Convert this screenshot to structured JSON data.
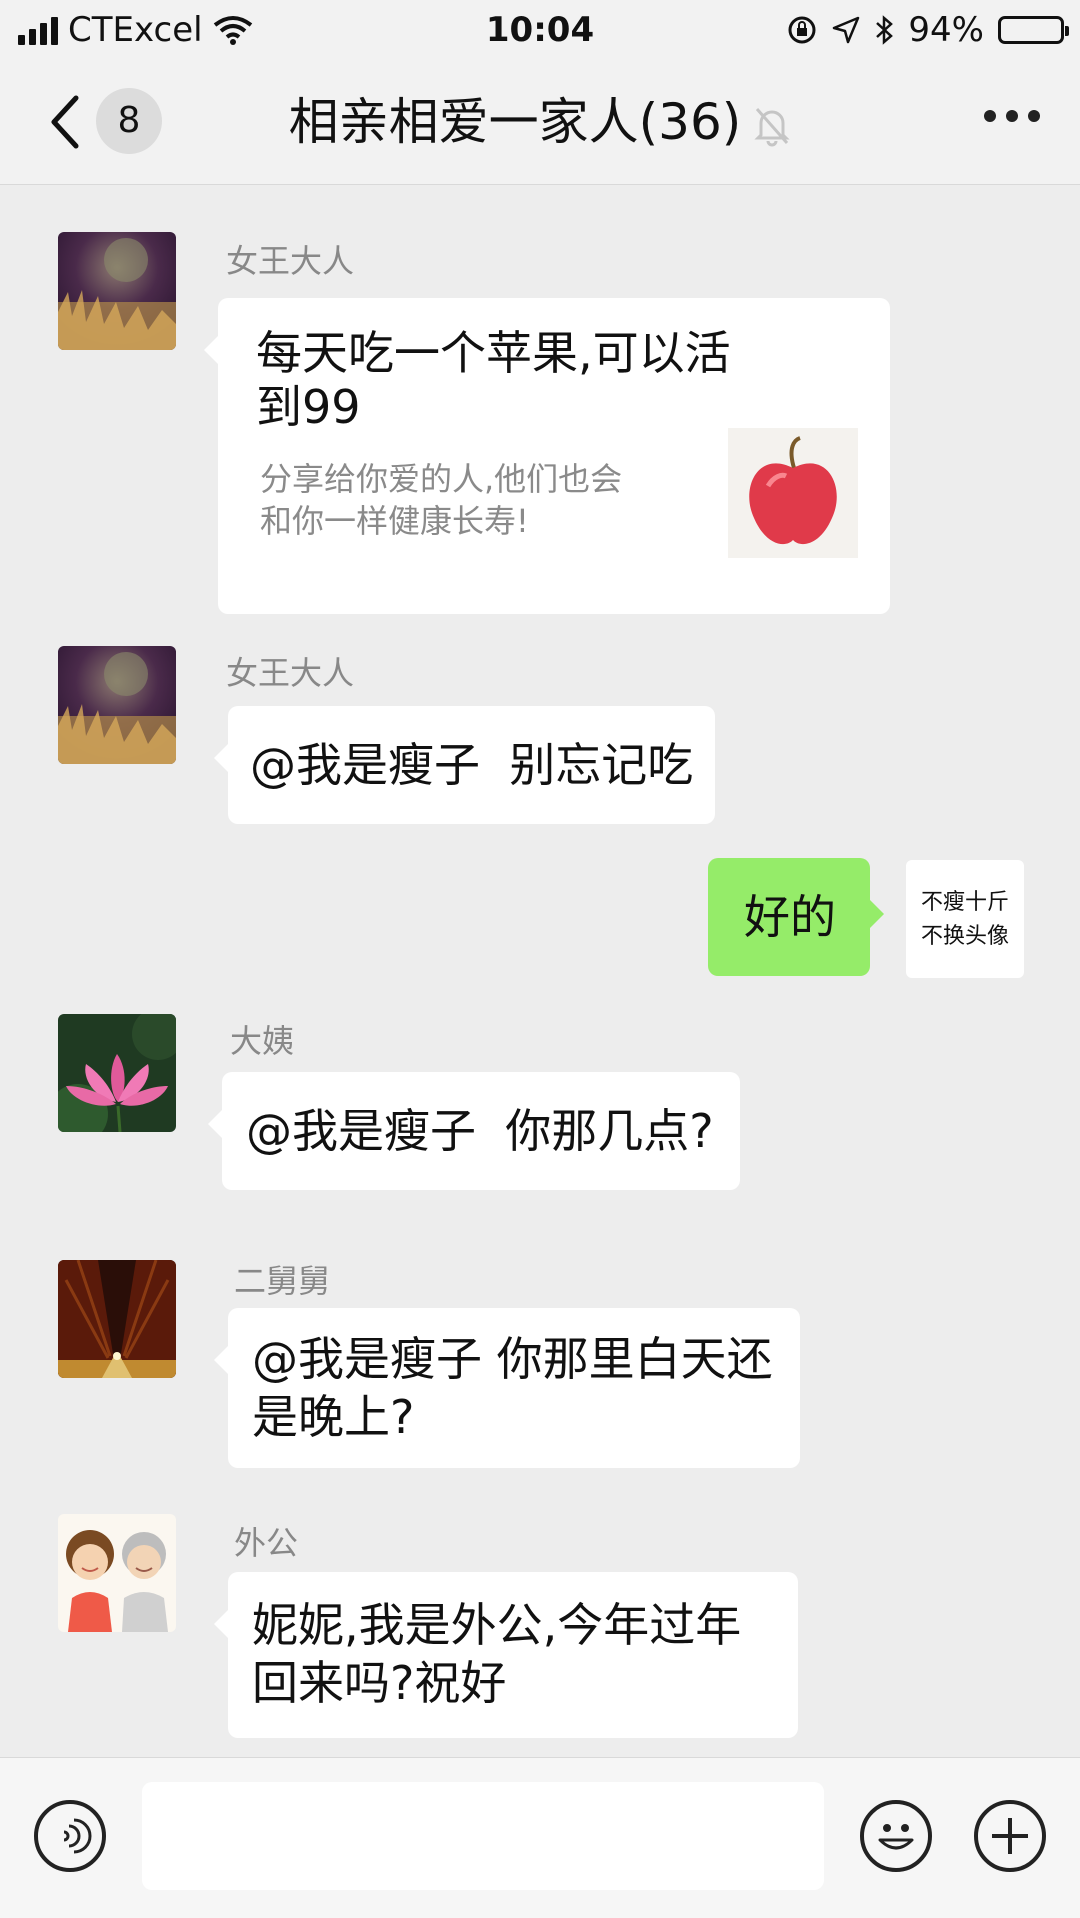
{
  "status_bar": {
    "carrier": "CTExcel",
    "time": "10:04",
    "battery": "94%",
    "battery_level": 0.94
  },
  "nav": {
    "unread_count": "8",
    "title": "相亲相爱一家人(36)",
    "icons": [
      "back-chevron-icon",
      "mute-bell-icon",
      "more-icon"
    ]
  },
  "messages": [
    {
      "sender": "女王大人",
      "type": "link",
      "title": "每天吃一个苹果,可以活到99",
      "description": "分享给你爱的人,他们也会和你一样健康长寿!"
    },
    {
      "sender": "女王大人",
      "type": "text",
      "text": "@我是瘦子  别忘记吃"
    },
    {
      "sender": "self",
      "type": "text",
      "text": "好的",
      "avatar_text_line1": "不瘦十斤",
      "avatar_text_line2": "不换头像"
    },
    {
      "sender": "大姨",
      "type": "text",
      "text": "@我是瘦子  你那几点?"
    },
    {
      "sender": "二舅舅",
      "type": "text",
      "text": "@我是瘦子  你那里白天还是晚上?"
    },
    {
      "sender": "外公",
      "type": "text",
      "text": "妮妮,我是外公,今年过年回来吗?祝好"
    }
  ],
  "input_bar": {
    "icons": [
      "voice-icon",
      "emoji-icon",
      "plus-icon"
    ],
    "text_value": ""
  }
}
